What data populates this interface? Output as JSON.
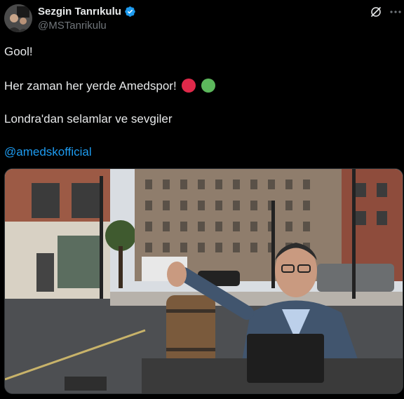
{
  "author": {
    "display_name": "Sezgin Tanrıkulu",
    "handle": "@MSTanrikulu"
  },
  "tweet": {
    "line1": "Gool!",
    "line2": "Her zaman her yerde Amedspor!",
    "line3": "Londra'dan selamlar ve sevgiler",
    "mention": "@amedskofficial",
    "emoji_colors": [
      "#e0294a",
      "#5cb85c"
    ]
  },
  "icons": {
    "verified": "verified-badge-icon",
    "grok": "grok-icon",
    "more": "more-options-icon"
  },
  "colors": {
    "background": "#000000",
    "text": "#e7e9ea",
    "secondary": "#71767b",
    "link": "#1d9bf0",
    "verified": "#1d9bf0"
  }
}
